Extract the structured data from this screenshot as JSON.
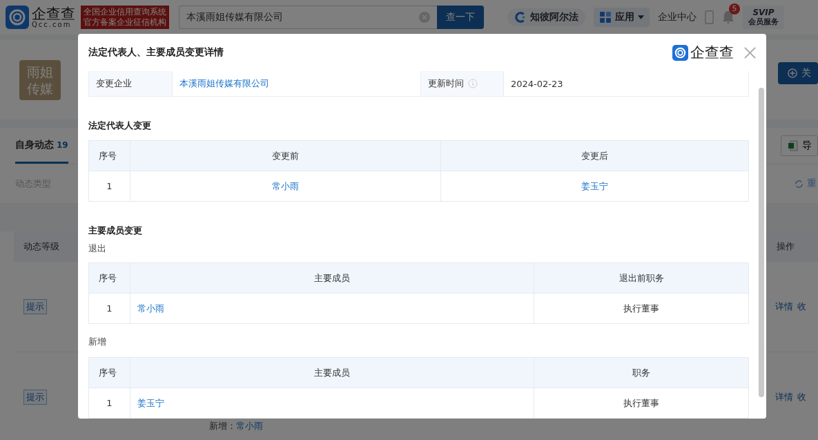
{
  "header": {
    "logo_text": "企查查",
    "logo_domain": "Qcc.com",
    "badge_lines": [
      "全国企业信用查询系统",
      "官方备案企业征信机构"
    ],
    "search": {
      "value": "本溪雨姐传媒有限公司"
    },
    "search_button": "查一下",
    "nav": [
      {
        "kind": "alpha",
        "label": "知彼阿尔法"
      },
      {
        "kind": "apps",
        "label": "应用"
      },
      {
        "kind": "text",
        "label": "企业中心"
      },
      {
        "kind": "phone"
      },
      {
        "kind": "bell",
        "badge": "5"
      },
      {
        "kind": "vip",
        "label": "SVIP",
        "sublabel": "会员服务"
      }
    ]
  },
  "company": {
    "avatar_lines": [
      "雨姐",
      "传媒"
    ],
    "follow_button": "关"
  },
  "tabs": [
    {
      "label": "自身动态",
      "count": "19",
      "selected": true
    }
  ],
  "export_button": "导",
  "filter_label": "动态类型",
  "reset_button": "重",
  "table": {
    "columns": [
      "动态等级",
      "操作"
    ],
    "rows": [
      {
        "level_tag": "提示",
        "actions": [
          "详情",
          "收"
        ]
      },
      {
        "level_tag": "提示",
        "actions": [
          "详情",
          "收"
        ],
        "detail_label": "新增：",
        "detail_value": "常小雨"
      }
    ]
  },
  "modal": {
    "title": "法定代表人、主要成员变更详情",
    "brand": "企查查",
    "info": [
      {
        "label": "变更企业",
        "value": "本溪雨姐传媒有限公司",
        "link": true,
        "info_icon": false
      },
      {
        "label": "更新时间",
        "value": "2024-02-23",
        "link": false,
        "info_icon": true
      }
    ],
    "legal_change": {
      "title": "法定代表人变更",
      "columns": [
        "序号",
        "变更前",
        "变更后"
      ],
      "rows": [
        [
          "1",
          "常小雨",
          "姜玉宁"
        ]
      ]
    },
    "member_change": {
      "title": "主要成员变更",
      "groups": [
        {
          "label": "退出",
          "columns": [
            "序号",
            "主要成员",
            "退出前职务"
          ],
          "rows": [
            [
              "1",
              "常小雨",
              "执行董事"
            ]
          ]
        },
        {
          "label": "新增",
          "columns": [
            "序号",
            "主要成员",
            "职务"
          ],
          "rows": [
            [
              "1",
              "姜玉宁",
              "执行董事"
            ]
          ]
        }
      ]
    }
  }
}
